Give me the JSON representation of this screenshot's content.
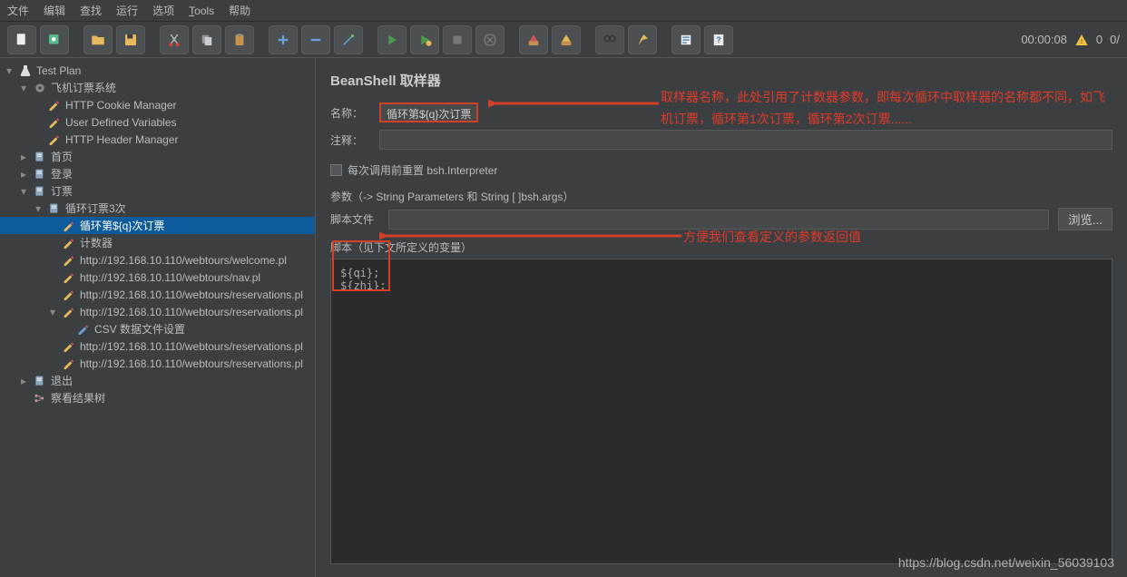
{
  "menu": [
    "文件",
    "编辑",
    "查找",
    "运行",
    "选项",
    "Tools",
    "帮助"
  ],
  "toolbar_icons": [
    "file-new",
    "file-templates",
    "folder-open",
    "save",
    "cut",
    "copy",
    "paste",
    "plus",
    "minus",
    "wand",
    "play",
    "play-check",
    "stop",
    "stop-all",
    "shutdown",
    "broom-red",
    "broom-yellow",
    "search-binoculars",
    "function",
    "list",
    "help"
  ],
  "timer": {
    "elapsed": "00:00:08",
    "warn_count": "0",
    "err_count": "0/"
  },
  "tree": [
    {
      "lvl": 0,
      "exp": "▾",
      "icon": "flask",
      "label": "Test Plan"
    },
    {
      "lvl": 1,
      "exp": "▾",
      "icon": "gear",
      "label": "飞机订票系统"
    },
    {
      "lvl": 2,
      "exp": "",
      "icon": "pen",
      "label": "HTTP Cookie Manager"
    },
    {
      "lvl": 2,
      "exp": "",
      "icon": "pen",
      "label": "User Defined Variables"
    },
    {
      "lvl": 2,
      "exp": "",
      "icon": "pen",
      "label": "HTTP Header Manager"
    },
    {
      "lvl": 1,
      "exp": "▸",
      "icon": "page",
      "label": "首页"
    },
    {
      "lvl": 1,
      "exp": "▸",
      "icon": "page",
      "label": "登录"
    },
    {
      "lvl": 1,
      "exp": "▾",
      "icon": "page",
      "label": "订票"
    },
    {
      "lvl": 2,
      "exp": "▾",
      "icon": "page",
      "label": "循环订票3次"
    },
    {
      "lvl": 3,
      "exp": "",
      "icon": "pen",
      "label": "循环第${q}次订票",
      "selected": true
    },
    {
      "lvl": 3,
      "exp": "",
      "icon": "pen",
      "label": "计数器"
    },
    {
      "lvl": 3,
      "exp": "",
      "icon": "pen",
      "label": "http://192.168.10.110/webtours/welcome.pl"
    },
    {
      "lvl": 3,
      "exp": "",
      "icon": "pen",
      "label": "http://192.168.10.110/webtours/nav.pl"
    },
    {
      "lvl": 3,
      "exp": "",
      "icon": "pen",
      "label": "http://192.168.10.110/webtours/reservations.pl"
    },
    {
      "lvl": 3,
      "exp": "▾",
      "icon": "pen",
      "label": "http://192.168.10.110/webtours/reservations.pl"
    },
    {
      "lvl": 4,
      "exp": "",
      "icon": "csv",
      "label": "CSV 数据文件设置"
    },
    {
      "lvl": 3,
      "exp": "",
      "icon": "pen",
      "label": "http://192.168.10.110/webtours/reservations.pl"
    },
    {
      "lvl": 3,
      "exp": "",
      "icon": "pen",
      "label": "http://192.168.10.110/webtours/reservations.pl"
    },
    {
      "lvl": 1,
      "exp": "▸",
      "icon": "page",
      "label": "退出"
    },
    {
      "lvl": 1,
      "exp": "",
      "icon": "tree",
      "label": "察看结果树"
    }
  ],
  "panel": {
    "title": "BeanShell 取样器",
    "name_label": "名称：",
    "name_value": "循环第${q}次订票",
    "comment_label": "注释：",
    "comment_value": "",
    "check_label": "每次调用前重置 bsh.Interpreter",
    "params_label": "参数（-> String Parameters 和 String [ ]bsh.args）",
    "scriptfile_label": "脚本文件",
    "browse_label": "浏览...",
    "scriptvars_label": "脚本（见下文所定义的变量）",
    "script_text": "${qi};\n${zhi};"
  },
  "annotations": {
    "a1": "取样器名称，此处引用了计数器参数，即每次循环中取样器的名称都不同，如飞机订票，循环第1次订票，循环第2次订票......",
    "a2": "方便我们查看定义的参数返回值"
  },
  "watermark": "https://blog.csdn.net/weixin_56039103"
}
